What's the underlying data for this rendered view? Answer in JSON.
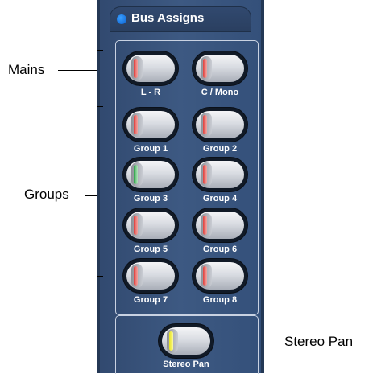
{
  "panel": {
    "title": "Bus Assigns",
    "accent": "#0a5fcf",
    "background": "#3d5982"
  },
  "mains": [
    {
      "label": "L - R",
      "lamp": "red"
    },
    {
      "label": "C / Mono",
      "lamp": "red"
    }
  ],
  "groups": [
    {
      "label": "Group 1",
      "lamp": "red"
    },
    {
      "label": "Group 2",
      "lamp": "red"
    },
    {
      "label": "Group 3",
      "lamp": "green"
    },
    {
      "label": "Group 4",
      "lamp": "red"
    },
    {
      "label": "Group 5",
      "lamp": "red"
    },
    {
      "label": "Group 6",
      "lamp": "red"
    },
    {
      "label": "Group 7",
      "lamp": "red"
    },
    {
      "label": "Group 8",
      "lamp": "red"
    }
  ],
  "stereo_pan": {
    "label": "Stereo Pan",
    "lamp": "yellow"
  },
  "callouts": {
    "mains": "Mains",
    "groups": "Groups",
    "stereo_pan": "Stereo Pan"
  }
}
